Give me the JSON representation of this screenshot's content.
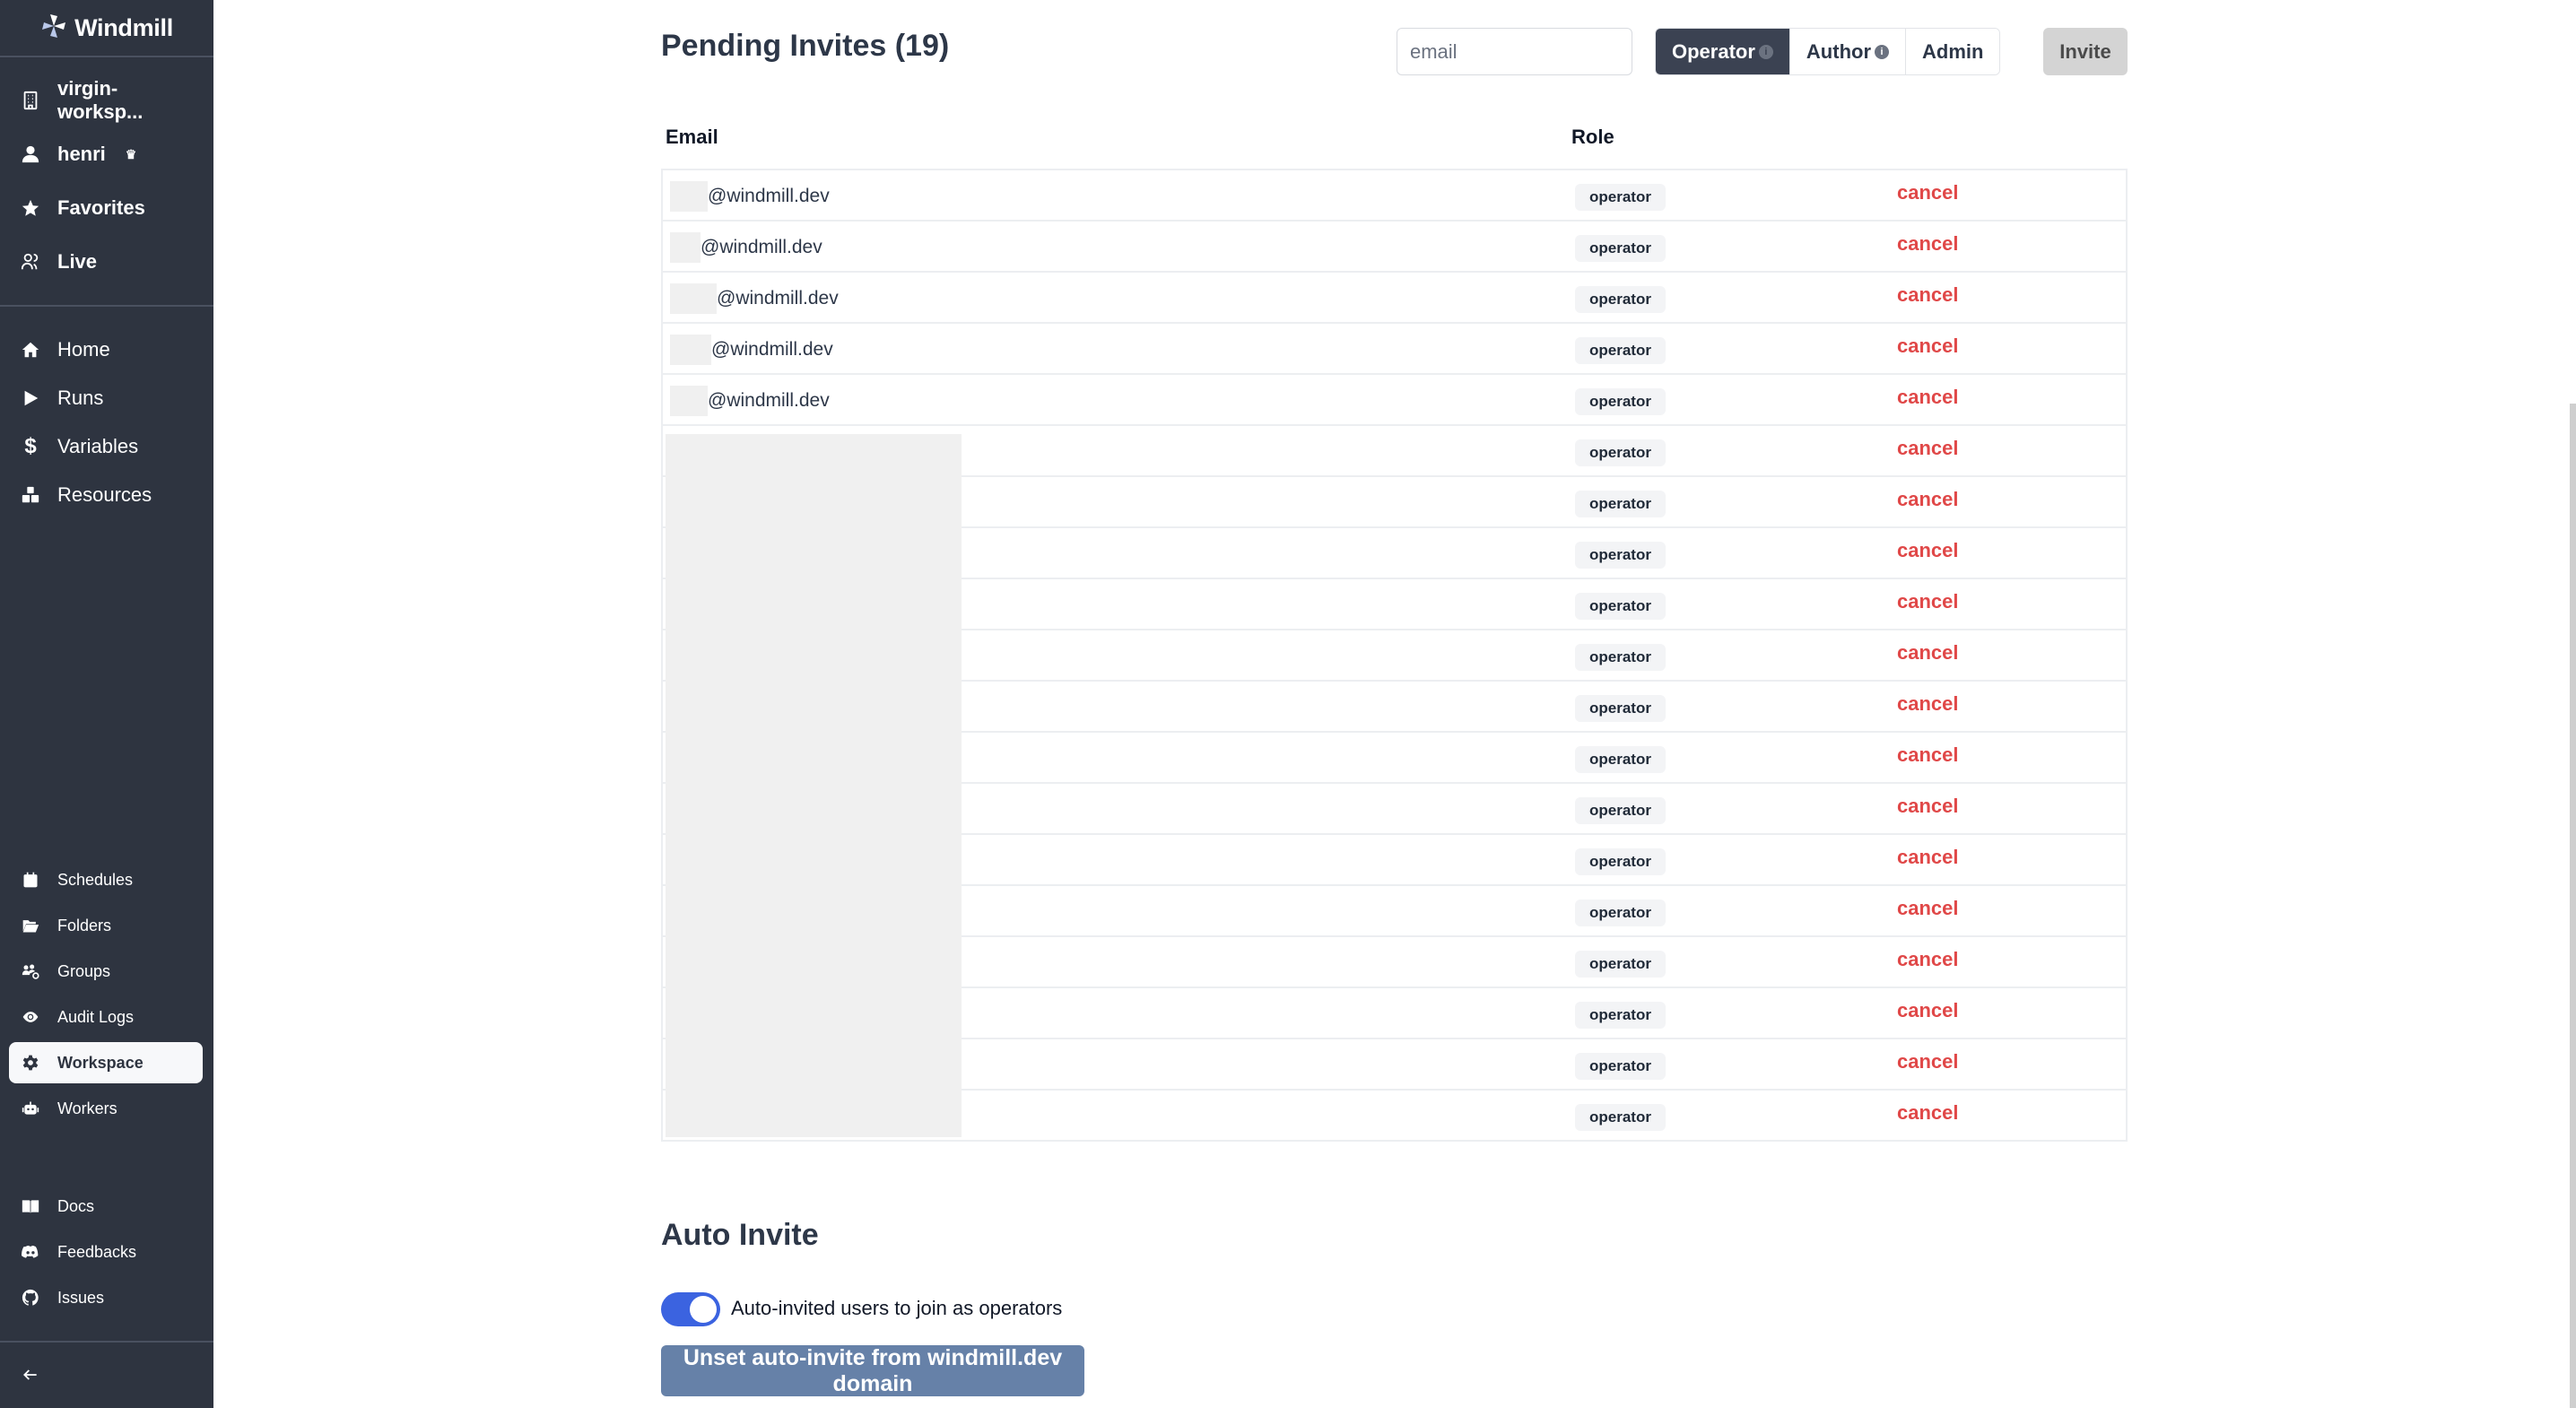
{
  "sidebar": {
    "brand": "Windmill",
    "top_items": [
      {
        "label": "virgin-worksp...",
        "icon": "building-icon"
      },
      {
        "label": "henri",
        "icon": "user-icon",
        "badge": "♛"
      },
      {
        "label": "Favorites",
        "icon": "star-icon"
      },
      {
        "label": "Live",
        "icon": "users-icon"
      }
    ],
    "main_items": [
      {
        "label": "Home",
        "icon": "home-icon"
      },
      {
        "label": "Runs",
        "icon": "play-icon"
      },
      {
        "label": "Variables",
        "icon": "dollar-icon"
      },
      {
        "label": "Resources",
        "icon": "cubes-icon"
      }
    ],
    "settings_items": [
      {
        "label": "Schedules",
        "icon": "calendar-icon"
      },
      {
        "label": "Folders",
        "icon": "folder-open-icon"
      },
      {
        "label": "Groups",
        "icon": "users-cog-icon"
      },
      {
        "label": "Audit Logs",
        "icon": "eye-icon"
      },
      {
        "label": "Workspace",
        "icon": "gear-icon",
        "active": true
      },
      {
        "label": "Workers",
        "icon": "robot-icon"
      }
    ],
    "help_items": [
      {
        "label": "Docs",
        "icon": "book-icon"
      },
      {
        "label": "Feedbacks",
        "icon": "discord-icon"
      },
      {
        "label": "Issues",
        "icon": "github-icon"
      }
    ],
    "collapse_icon": "arrow-left-icon"
  },
  "pending": {
    "title": "Pending Invites (19)",
    "email_placeholder": "email",
    "roles": [
      {
        "label": "Operator",
        "info": true,
        "selected": true
      },
      {
        "label": "Author",
        "info": true,
        "selected": false
      },
      {
        "label": "Admin",
        "info": false,
        "selected": false
      }
    ],
    "invite_label": "Invite",
    "columns": {
      "email": "Email",
      "role": "Role"
    },
    "rows": [
      {
        "email": "@windmill.dev",
        "role": "operator",
        "action": "cancel"
      },
      {
        "email": "@windmill.dev",
        "role": "operator",
        "action": "cancel"
      },
      {
        "email": "@windmill.dev",
        "role": "operator",
        "action": "cancel"
      },
      {
        "email": "@windmill.dev",
        "role": "operator",
        "action": "cancel"
      },
      {
        "email": "@windmill.dev",
        "role": "operator",
        "action": "cancel"
      },
      {
        "email": "",
        "role": "operator",
        "action": "cancel"
      },
      {
        "email": "",
        "role": "operator",
        "action": "cancel"
      },
      {
        "email": "",
        "role": "operator",
        "action": "cancel"
      },
      {
        "email": "",
        "role": "operator",
        "action": "cancel"
      },
      {
        "email": "",
        "role": "operator",
        "action": "cancel"
      },
      {
        "email": "",
        "role": "operator",
        "action": "cancel"
      },
      {
        "email": "",
        "role": "operator",
        "action": "cancel"
      },
      {
        "email": "",
        "role": "operator",
        "action": "cancel"
      },
      {
        "email": "",
        "role": "operator",
        "action": "cancel"
      },
      {
        "email": "",
        "role": "operator",
        "action": "cancel"
      },
      {
        "email": "",
        "role": "operator",
        "action": "cancel"
      },
      {
        "email": "",
        "role": "operator",
        "action": "cancel"
      },
      {
        "email": "",
        "role": "operator",
        "action": "cancel"
      },
      {
        "email": "",
        "role": "operator",
        "action": "cancel"
      }
    ]
  },
  "auto_invite": {
    "title": "Auto Invite",
    "toggle_on": true,
    "toggle_label": "Auto-invited users to join as operators",
    "unset_label": "Unset auto-invite from windmill.dev domain"
  },
  "colors": {
    "sidebar_bg": "#2e3440",
    "accent_toggle": "#3b63e0",
    "cancel": "#e04848",
    "unset_button": "#6681a8",
    "selected_role": "#3b4252"
  }
}
